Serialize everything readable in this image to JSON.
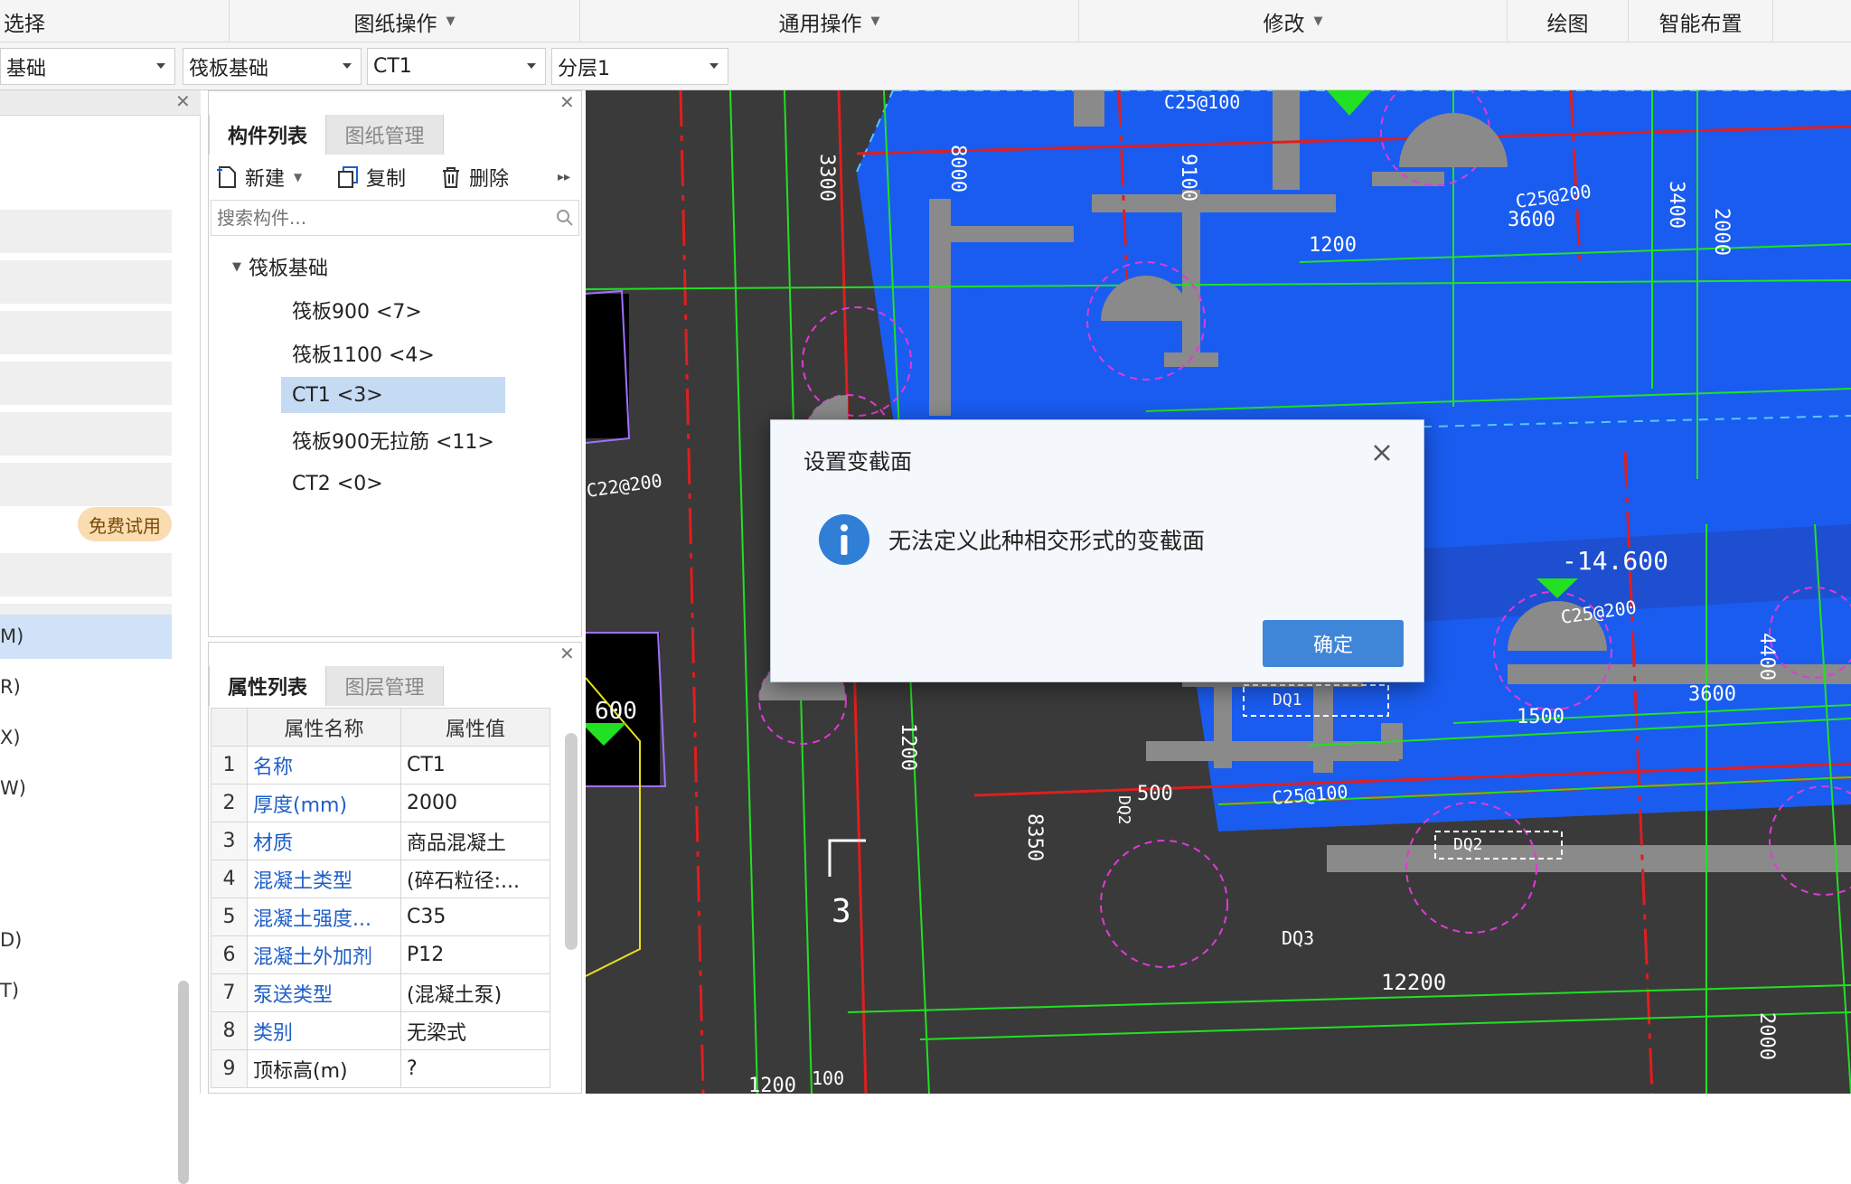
{
  "menubar": {
    "select": "选择",
    "drawing_ops": "图纸操作",
    "common_ops": "通用操作",
    "modify": "修改",
    "draw": "绘图",
    "smart_layout": "智能布置"
  },
  "selectors": {
    "category": "基础",
    "type": "筏板基础",
    "component": "CT1",
    "layer": "分层1"
  },
  "leftnav": {
    "trial_badge": "免费试用",
    "labels": [
      "M)",
      "R)",
      "X)",
      "W)",
      "D)",
      "T)"
    ]
  },
  "component_panel": {
    "tab_list": "构件列表",
    "tab_drawings": "图纸管理",
    "btn_new": "新建",
    "btn_copy": "复制",
    "btn_delete": "删除",
    "search_placeholder": "搜索构件...",
    "tree_root": "筏板基础",
    "tree_items": [
      "筏板900 <7>",
      "筏板1100 <4>",
      "CT1 <3>",
      "筏板900无拉筋 <11>",
      "CT2 <0>"
    ],
    "selected_index": 2
  },
  "property_panel": {
    "tab_props": "属性列表",
    "tab_layers": "图层管理",
    "col_name": "属性名称",
    "col_value": "属性值",
    "rows": [
      {
        "idx": "1",
        "name": "名称",
        "value": "CT1"
      },
      {
        "idx": "2",
        "name": "厚度(mm)",
        "value": "2000"
      },
      {
        "idx": "3",
        "name": "材质",
        "value": "商品混凝土"
      },
      {
        "idx": "4",
        "name": "混凝土类型",
        "value": "(碎石粒径:..."
      },
      {
        "idx": "5",
        "name": "混凝土强度...",
        "value": "C35"
      },
      {
        "idx": "6",
        "name": "混凝土外加剂",
        "value": "P12"
      },
      {
        "idx": "7",
        "name": "泵送类型",
        "value": "(混凝土泵)"
      },
      {
        "idx": "8",
        "name": "类别",
        "value": "无梁式"
      },
      {
        "idx": "9",
        "name": "顶标高(m)",
        "value": "?"
      }
    ]
  },
  "canvas_labels": {
    "dim_3300": "3300",
    "dim_8000": "8000",
    "dim_9100": "9100",
    "rebar_top": "C25@100",
    "rebar_left": "C22@200",
    "rebar_mid": "C25@200",
    "rebar_right": "C25@200",
    "rebar_bottom": "C25@100",
    "dim_1200": "1200",
    "dim_3600a": "3600",
    "dim_3400": "3400",
    "dim_2000a": "2000",
    "dim_1500": "1500",
    "dim_3600b": "3600",
    "dim_4400": "4400",
    "elev": "-14.600",
    "elev_left": "600",
    "dim_1200v": "1200",
    "dim_8350": "8350",
    "dim_500": "500",
    "dq1": "DQ1",
    "dq2a": "DQ2",
    "dq2b": "DQ2",
    "dq3": "DQ3",
    "dim_12200": "12200",
    "section_no": "3",
    "dim_2000b": "2000",
    "dim_1200b": "1200",
    "dim_100": "100"
  },
  "dialog": {
    "title": "设置变截面",
    "message": "无法定义此种相交形式的变截面",
    "ok_label": "确定"
  },
  "colors": {
    "cad_background": "#3a3a3a",
    "slab_blue": "#1a5cf0",
    "wall_grey": "#8a8a8a",
    "dim_green": "#22e022",
    "axis_red": "#e01e1e",
    "ok_button": "#3f86d8",
    "info_icon": "#2f7fd6"
  }
}
